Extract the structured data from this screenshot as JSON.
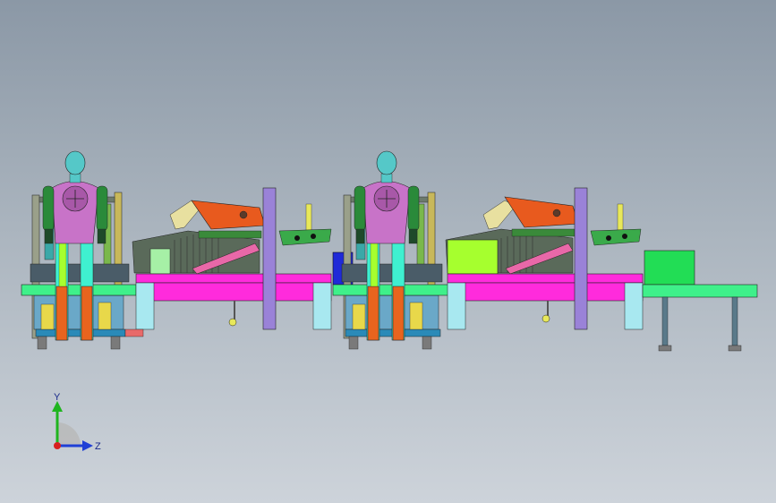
{
  "viewport": {
    "background_top": "#8b98a6",
    "background_bottom": "#cdd3da"
  },
  "triad": {
    "y_label": "Y",
    "z_label": "Z",
    "y_color": "#1fb51f",
    "z_color": "#1f3fd6",
    "x_color": "#d81f1f"
  },
  "colors": {
    "magenta": "#ff2bdc",
    "purple": "#9a82d8",
    "green_conveyor": "#3ff08a",
    "orange": "#e8641e",
    "lime": "#a6ff2e",
    "cyan": "#55d8e8",
    "blue": "#1f2ad8",
    "yellow": "#e8e85a",
    "robot_body": "#c873c8",
    "robot_head": "#55c8c8"
  }
}
